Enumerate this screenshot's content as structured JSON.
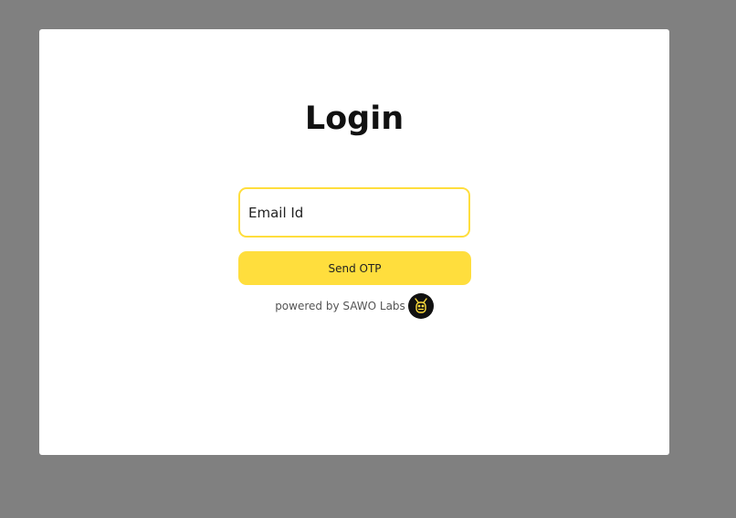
{
  "login": {
    "title": "Login",
    "email_placeholder": "Email Id",
    "send_otp_label": "Send OTP",
    "powered_by": "powered by SAWO Labs",
    "logo_icon": "sawo-labs-logo-icon"
  },
  "colors": {
    "accent": "#FFDE3D",
    "backdrop": "#808080",
    "card": "#FFFFFF",
    "logo_bg": "#111111"
  }
}
